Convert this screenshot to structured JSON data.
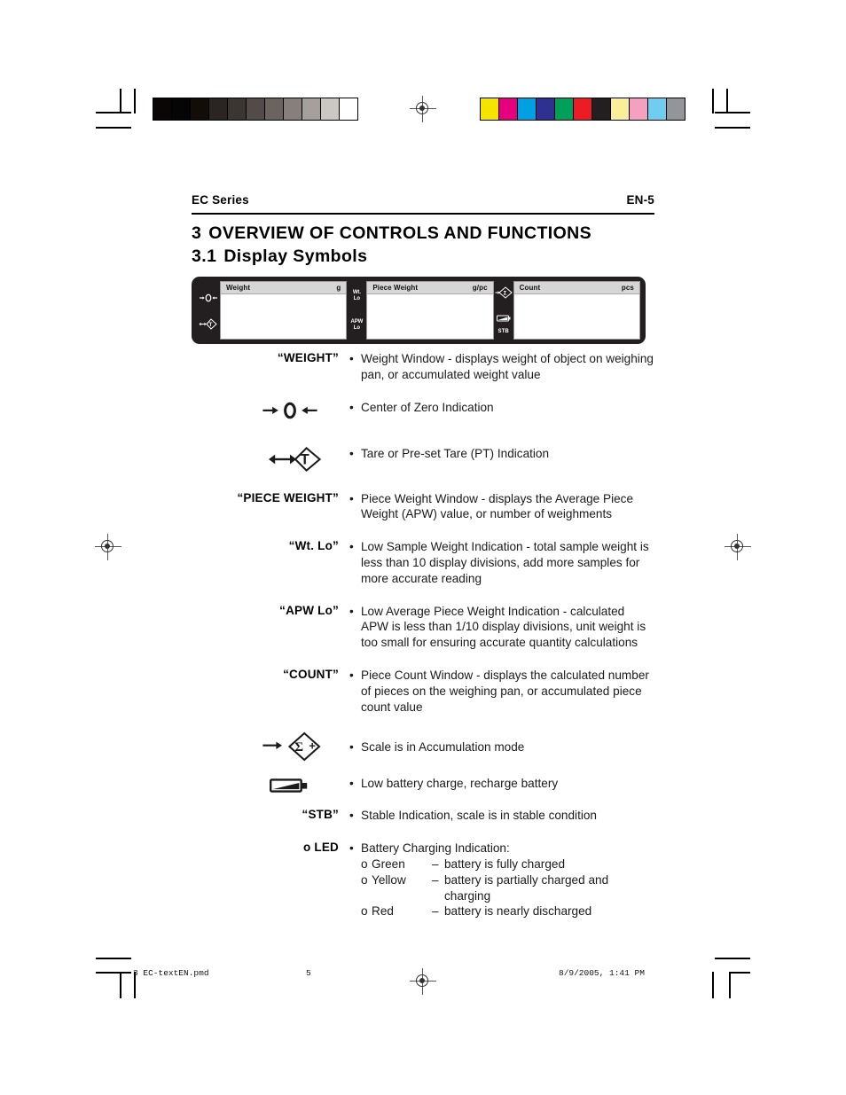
{
  "page": {
    "running_head_left": "EC Series",
    "running_head_right": "EN-5",
    "section_number": "3",
    "section_title": "OVERVIEW  OF  CONTROLS  AND  FUNCTIONS",
    "subsection_number": "3.1",
    "subsection_title": "Display Symbols"
  },
  "lcd": {
    "windows": [
      {
        "title": "Weight",
        "unit": "g"
      },
      {
        "title": "Piece Weight",
        "unit": "g/pc"
      },
      {
        "title": "Count",
        "unit": "pcs"
      }
    ],
    "left_indicators": [
      {
        "name": "center-of-zero",
        "label": ""
      },
      {
        "name": "tare",
        "label": ""
      }
    ],
    "middle_indicators": [
      {
        "name": "low-sample-weight",
        "label": "Wt.\nLo"
      },
      {
        "name": "low-average-piece-weight",
        "label": "APW\nLo"
      }
    ],
    "right_indicators": [
      {
        "name": "accumulation",
        "label": ""
      },
      {
        "name": "low-battery",
        "label": ""
      },
      {
        "name": "stable",
        "label": "STB"
      }
    ]
  },
  "rows": [
    {
      "label": "“WEIGHT”",
      "label_kind": "text",
      "symbol": "",
      "bullet": "•",
      "text": "Weight Window - displays weight of object on weighing pan, or accumulated weight value"
    },
    {
      "label": "",
      "label_kind": "symbol-center-of-zero",
      "symbol": "center-of-zero-symbol",
      "bullet": "•",
      "text": "Center of Zero Indication"
    },
    {
      "label": "",
      "label_kind": "symbol-tare",
      "symbol": "tare-symbol",
      "bullet": "•",
      "text": "Tare or Pre-set Tare (PT) Indication"
    },
    {
      "label": "“PIECE WEIGHT”",
      "label_kind": "text",
      "symbol": "",
      "bullet": "•",
      "text": "Piece Weight Window - displays the Average Piece Weight (APW) value, or number of weighments"
    },
    {
      "label": "“Wt. Lo”",
      "label_kind": "text",
      "symbol": "",
      "bullet": "•",
      "text": "Low Sample Weight Indication - total sample weight is less than 10 display divisions, add more samples for more accurate reading"
    },
    {
      "label": "“APW Lo”",
      "label_kind": "text",
      "symbol": "",
      "bullet": "•",
      "text": "Low Average Piece Weight Indication - calculated APW is less than 1/10 display divisions, unit weight is too small for ensuring accurate quantity calculations"
    },
    {
      "label": "“COUNT”",
      "label_kind": "text",
      "symbol": "",
      "bullet": "•",
      "text": "Piece Count Window - displays the calculated number of pieces on the weighing pan, or accumulated piece count value"
    },
    {
      "label": "",
      "label_kind": "symbol-accumulation",
      "symbol": "accumulation-symbol",
      "bullet": "•",
      "text": "Scale is in Accumulation mode"
    },
    {
      "label": "",
      "label_kind": "symbol-battery",
      "symbol": "low-battery-symbol",
      "bullet": "•",
      "text": "Low battery charge, recharge battery"
    },
    {
      "label": "“STB”",
      "label_kind": "text",
      "symbol": "",
      "bullet": "•",
      "text": "Stable Indication, scale is in stable condition"
    }
  ],
  "led_row": {
    "label": "o LED",
    "bullet": "•",
    "heading": "Battery Charging Indication:",
    "items": [
      {
        "marker": "o",
        "color_name": "Green",
        "dash": "–",
        "desc": "battery is fully charged"
      },
      {
        "marker": "o",
        "color_name": "Yellow",
        "dash": "–",
        "desc": "battery is partially charged and"
      },
      {
        "marker": "o",
        "color_name": "",
        "dash": "",
        "desc": "charging",
        "continuation": true
      },
      {
        "marker": "o",
        "color_name": "Red",
        "dash": "–",
        "desc": "battery is nearly discharged"
      }
    ]
  },
  "footer": {
    "file": "3 EC-textEN.pmd",
    "page_number": "5",
    "timestamp": "8/9/2005, 1:41 PM"
  },
  "calibration": {
    "grayscale": [
      "#0a0606",
      "#050505",
      "#120d09",
      "#2a2522",
      "#3c3633",
      "#524b47",
      "#6b635e",
      "#877f7b",
      "#a6a09c",
      "#cbc7c3",
      "#ffffff"
    ],
    "colors": [
      "#f5e400",
      "#e6007e",
      "#00a0e3",
      "#2e3192",
      "#00a05a",
      "#ed1c24",
      "#231f20",
      "#faee9a",
      "#f5a0bf",
      "#6fcdf0",
      "#939598"
    ]
  }
}
